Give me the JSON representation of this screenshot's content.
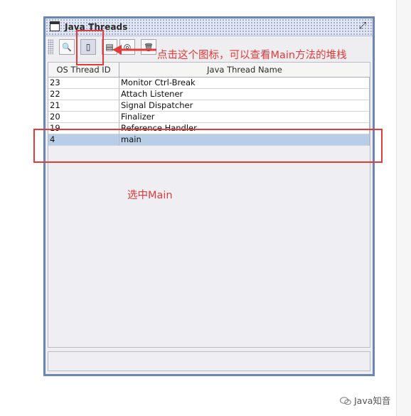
{
  "window": {
    "title": "Java Threads",
    "restore_glyph": "⤢"
  },
  "toolbar": {
    "buttons": [
      {
        "name": "inspect-thread",
        "glyph": "🔍"
      },
      {
        "name": "stack-trace",
        "glyph": "▯"
      },
      {
        "name": "thread-info",
        "glyph": "▤"
      },
      {
        "name": "find-deadlocks",
        "glyph": "◎"
      },
      {
        "name": "kill-thread",
        "glyph": "🗑"
      }
    ]
  },
  "table": {
    "columns": [
      "OS Thread ID",
      "Java Thread Name"
    ],
    "rows": [
      {
        "id": "23",
        "name": "Monitor Ctrl-Break",
        "selected": false
      },
      {
        "id": "22",
        "name": "Attach Listener",
        "selected": false
      },
      {
        "id": "21",
        "name": "Signal Dispatcher",
        "selected": false
      },
      {
        "id": "20",
        "name": "Finalizer",
        "selected": false
      },
      {
        "id": "19",
        "name": "Reference Handler",
        "selected": false
      },
      {
        "id": "4",
        "name": "main",
        "selected": true
      }
    ]
  },
  "annotations": {
    "icon_hint": "点击这个图标，可以查看Main方法的堆栈",
    "select_hint": "选中Main",
    "color": "#e53a3a"
  },
  "watermark": {
    "text": "Java知音"
  },
  "colors": {
    "frame_border": "#6a86b8",
    "selection": "#b8cde6"
  }
}
